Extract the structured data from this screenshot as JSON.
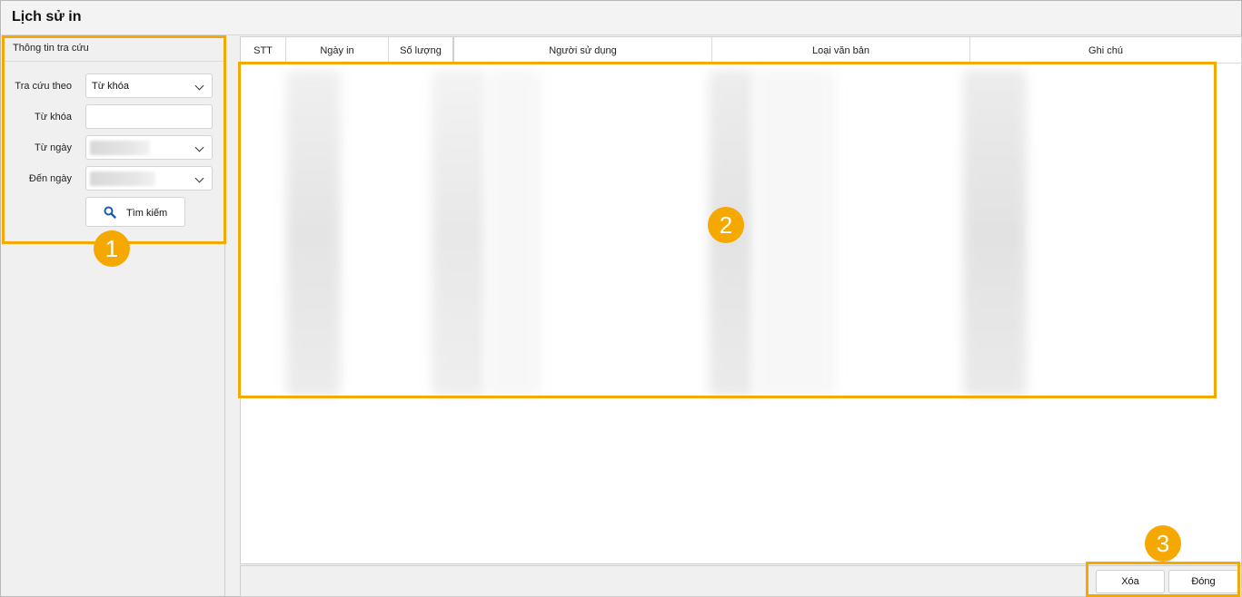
{
  "window": {
    "title": "Lịch sử in"
  },
  "search_panel": {
    "header": "Thông tin tra cứu",
    "search_by": {
      "label": "Tra cứu theo",
      "value": "Từ khóa"
    },
    "keyword": {
      "label": "Từ khóa",
      "value": ""
    },
    "from_date": {
      "label": "Từ ngày"
    },
    "to_date": {
      "label": "Đến ngày"
    },
    "search_button": "Tìm kiếm"
  },
  "table": {
    "columns": [
      "STT",
      "Ngày in",
      "Số lượng",
      "Người sử dụng",
      "Loại văn bản",
      "Ghi chú"
    ]
  },
  "footer": {
    "delete_button": "Xóa",
    "close_button": "Đóng"
  },
  "annotations": {
    "badges": [
      "1",
      "2",
      "3"
    ],
    "color": "#f5a800"
  },
  "colors": {
    "accent": "#f5a800",
    "search_icon": "#1f5bb5"
  }
}
